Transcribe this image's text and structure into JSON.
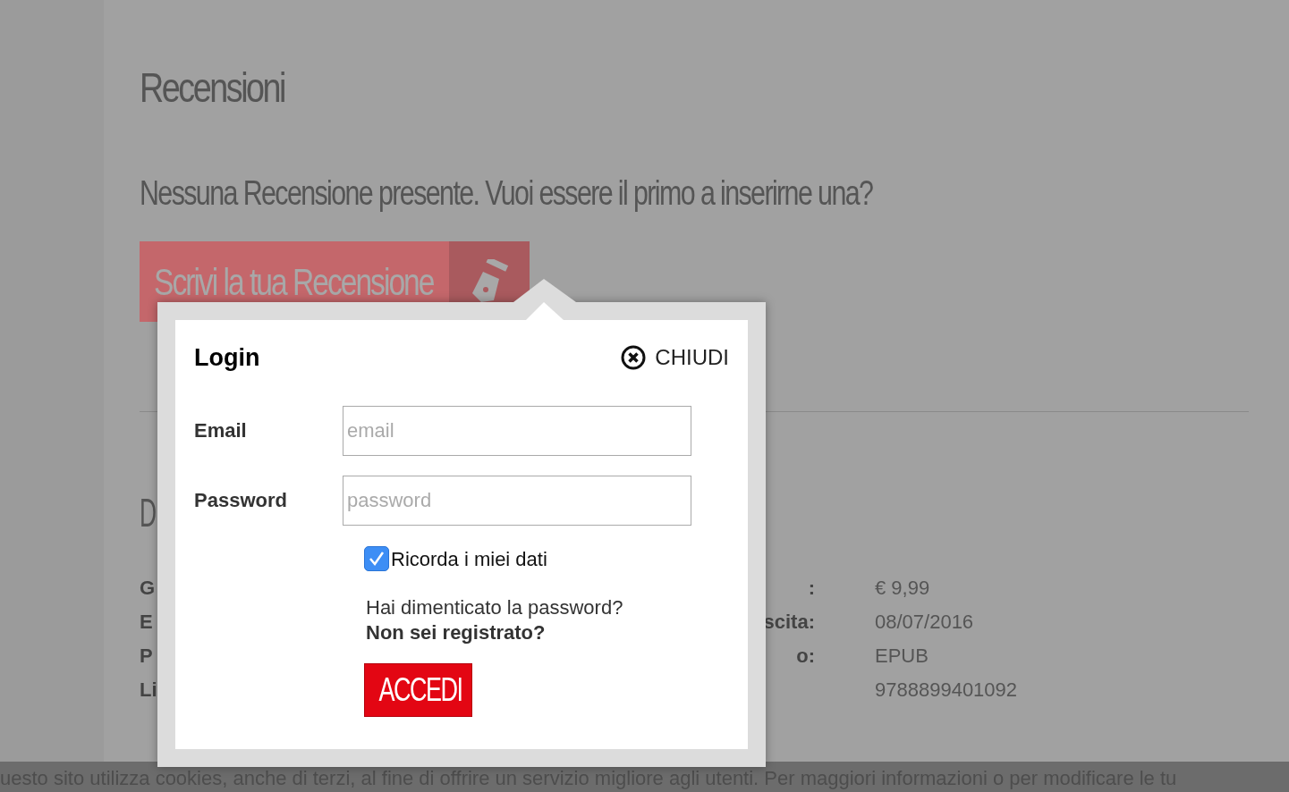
{
  "reviews": {
    "title": "Recensioni",
    "empty_message": "Nessuna Recensione presente. Vuoi essere il primo a inserirne una?",
    "write_button": "Scrivi la tua Recensione"
  },
  "details": {
    "heading": "D",
    "left_labels": [
      "G",
      "E",
      "P",
      "Li"
    ],
    "right_labels": [
      ":",
      "scita:",
      "o:"
    ],
    "values": [
      "€ 9,99",
      "08/07/2016",
      "EPUB",
      "9788899401092"
    ]
  },
  "login": {
    "title": "Login",
    "close": "CHIUDI",
    "fields": [
      {
        "label": "Email",
        "placeholder": "email"
      },
      {
        "label": "Password",
        "placeholder": "password"
      }
    ],
    "remember": {
      "label": "Ricorda i miei dati",
      "checked": true
    },
    "forgot_link": "Hai dimenticato la password?",
    "register_link": "Non sei registrato?",
    "submit": "ACCEDI"
  },
  "cookie_bar": {
    "text": "uesto sito utilizza cookies, anche di terzi, al fine di offrire un servizio migliore agli utenti. Per maggiori informazioni o per modificare le tu"
  }
}
